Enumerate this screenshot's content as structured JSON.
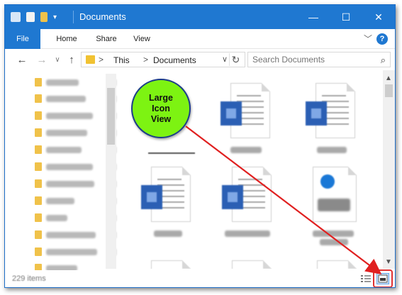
{
  "window": {
    "title": "Documents",
    "controls": {
      "minimize": "—",
      "maximize": "☐",
      "close": "✕"
    }
  },
  "ribbon": {
    "tabs": [
      "File",
      "Home",
      "Share",
      "View"
    ],
    "collapse_glyph": "﹀",
    "help_glyph": "?"
  },
  "navigation": {
    "back_glyph": "←",
    "forward_glyph": "→",
    "recent_glyph": "∨",
    "up_glyph": "↑",
    "path": [
      "This",
      "Documents"
    ],
    "separator_glyph": ">",
    "dropdown_glyph": "∨",
    "refresh_glyph": "↻",
    "search_placeholder": "Search Documents",
    "search_icon": "⌕"
  },
  "status": {
    "items_text": "229 items"
  },
  "callout": {
    "lines": [
      "Large",
      "Icon",
      "View"
    ]
  },
  "colors": {
    "titlebar": "#1f78d1",
    "callout_fill": "#7df312",
    "arrow": "#e02020"
  }
}
